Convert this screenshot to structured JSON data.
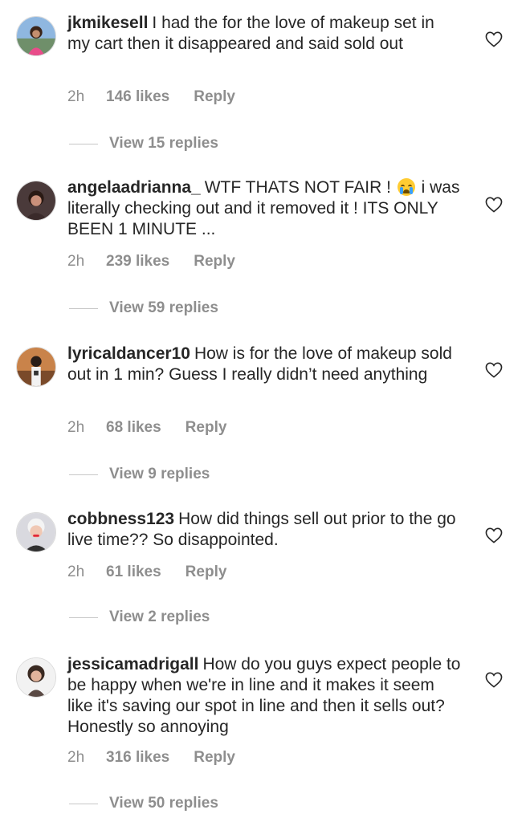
{
  "comments": [
    {
      "username": "jkmikesell",
      "text": "I had the for the love of makeup set in my cart then it disappeared and said sold out",
      "time": "2h",
      "likes": "146 likes",
      "reply": "Reply",
      "view_replies": "View 15 replies",
      "avatar_icon": "avatar-photo"
    },
    {
      "username": "angelaadrianna_",
      "text_before_emoji": "WTF THATS NOT FAIR !",
      "emoji": "crying-face-emoji",
      "text_after_emoji": "i was literally checking out and it removed it ! ITS ONLY BEEN 1 MINUTE ...",
      "time": "2h",
      "likes": "239 likes",
      "reply": "Reply",
      "view_replies": "View 59 replies",
      "avatar_icon": "avatar-photo"
    },
    {
      "username": "lyricaldancer10",
      "text": "How is for the love of makeup sold out in 1 min? Guess I really didn’t need anything",
      "time": "2h",
      "likes": "68 likes",
      "reply": "Reply",
      "view_replies": "View 9 replies",
      "avatar_icon": "avatar-photo"
    },
    {
      "username": "cobbness123",
      "text": "How did things sell out prior to the go live time?? So disappointed.",
      "time": "2h",
      "likes": "61 likes",
      "reply": "Reply",
      "view_replies": "View 2 replies",
      "avatar_icon": "avatar-photo"
    },
    {
      "username": "jessicamadrigall",
      "text": "How do you guys expect people to be happy when we're in line and it makes it seem like it's saving our spot in line and then it sells out? Honestly so annoying",
      "time": "2h",
      "likes": "316 likes",
      "reply": "Reply",
      "view_replies": "View 50 replies",
      "avatar_icon": "avatar-photo"
    }
  ],
  "icons": {
    "like": "heart-outline-icon"
  },
  "colors": {
    "text": "#262626",
    "muted": "#8e8e8e",
    "divider": "#c7c7c7"
  }
}
